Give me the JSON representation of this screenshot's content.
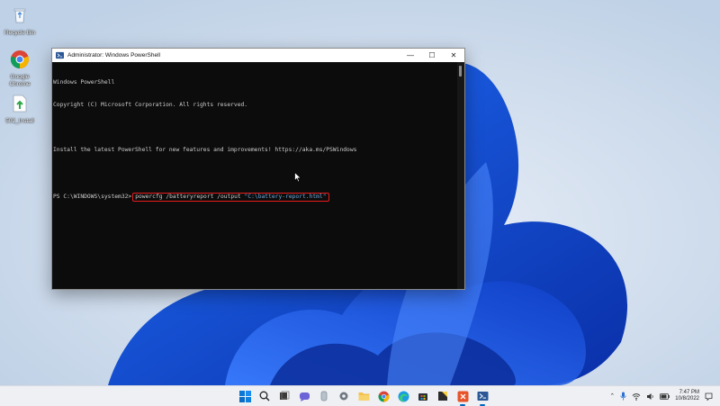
{
  "desktop": {
    "icons": [
      {
        "label": "Recycle Bin",
        "icon": "recycle-bin-icon"
      },
      {
        "label": "Google Chrome",
        "icon": "chrome-icon"
      },
      {
        "label": "502_Install",
        "icon": "installer-icon"
      }
    ]
  },
  "window": {
    "title": "Administrator: Windows PowerShell",
    "controls": {
      "minimize": "—",
      "maximize": "☐",
      "close": "✕"
    },
    "console": {
      "lines": [
        "Windows PowerShell",
        "Copyright (C) Microsoft Corporation. All rights reserved.",
        "",
        "Install the latest PowerShell for new features and improvements! https://aka.ms/PSWindows",
        ""
      ],
      "prompt": "PS C:\\WINDOWS\\system32>",
      "command": "powercfg /batteryreport /output",
      "argument": "\"C:\\battery-report.html\""
    }
  },
  "taskbar": {
    "apps": [
      {
        "name": "start",
        "icon": "windows-start-icon"
      },
      {
        "name": "search",
        "icon": "search-icon"
      },
      {
        "name": "task-view",
        "icon": "task-view-icon"
      },
      {
        "name": "chat",
        "icon": "chat-icon"
      },
      {
        "name": "widgets",
        "icon": "widgets-icon"
      },
      {
        "name": "settings",
        "icon": "gear-icon"
      },
      {
        "name": "file-explorer",
        "icon": "folder-icon"
      },
      {
        "name": "chrome",
        "icon": "chrome-icon"
      },
      {
        "name": "edge",
        "icon": "edge-icon"
      },
      {
        "name": "store",
        "icon": "store-icon"
      },
      {
        "name": "notes",
        "icon": "sticky-notes-icon"
      },
      {
        "name": "snip",
        "icon": "snipping-tool-icon"
      },
      {
        "name": "powershell",
        "icon": "powershell-icon"
      }
    ],
    "tray": {
      "time": "7:47 PM",
      "date": "10/8/2022"
    }
  },
  "colors": {
    "console_bg": "#0c0c0c",
    "console_text": "#cccccc",
    "highlight_box": "#e81c1c",
    "argument_text": "#6fa8dc",
    "accent": "#0067c0"
  }
}
